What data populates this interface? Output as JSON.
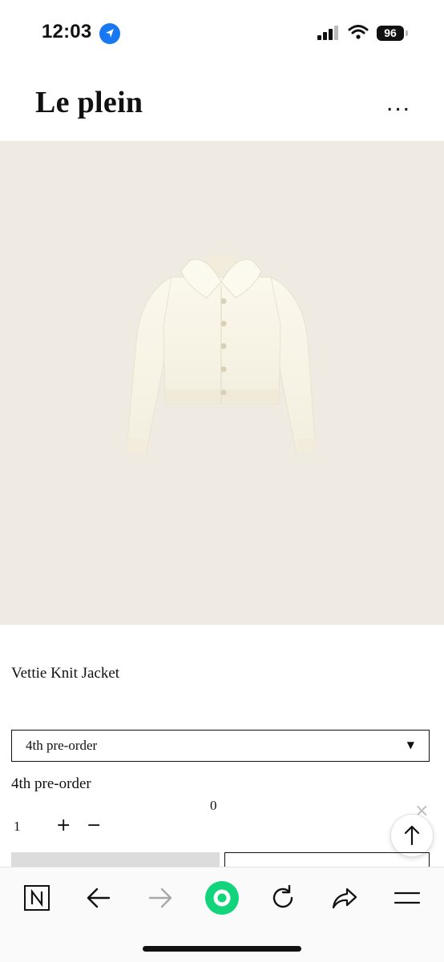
{
  "status_bar": {
    "time": "12:03",
    "battery": "96"
  },
  "header": {
    "brand": "Le plein",
    "more_label": "..."
  },
  "product": {
    "title": "Vettie Knit Jacket",
    "select": {
      "selected": "4th pre-order"
    },
    "option_label": "4th pre-order",
    "price": "0",
    "quantity": "1",
    "plus_label": "+",
    "minus_label": "−",
    "remove_label": "×"
  },
  "colors": {
    "accent_green": "#12d47a",
    "hero_bg": "#efebe2",
    "location_blue": "#1877f2"
  },
  "icons": [
    "location-arrow-icon",
    "signal-icon",
    "wifi-icon",
    "battery-icon",
    "more-icon",
    "arrow-up-icon",
    "naver-icon",
    "back-arrow-icon",
    "forward-arrow-icon",
    "green-dot-icon",
    "reload-icon",
    "share-icon",
    "menu-icon"
  ]
}
